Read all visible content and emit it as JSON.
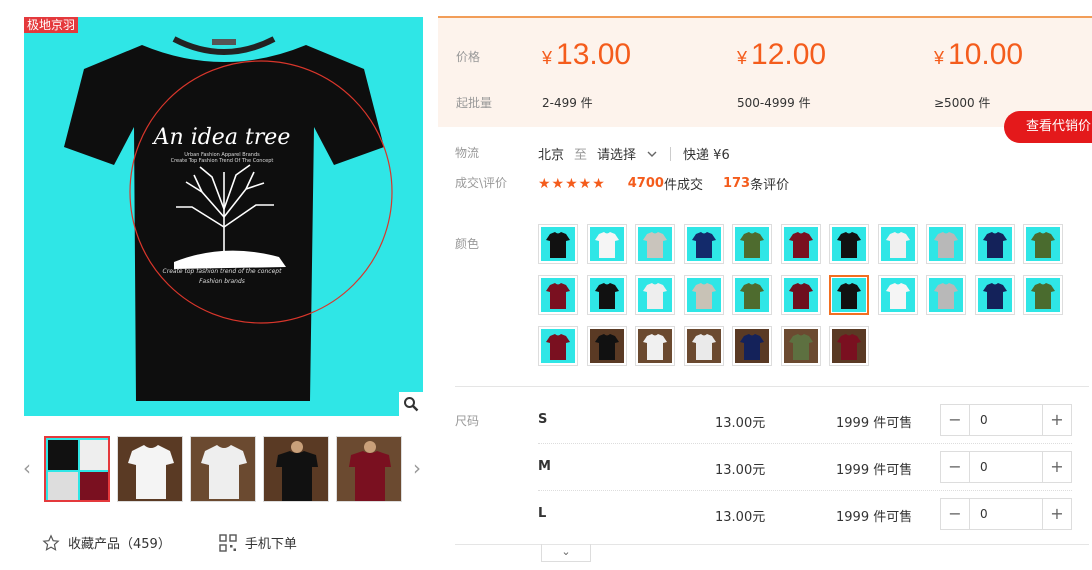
{
  "gallery": {
    "brand_tag": "极地京羽",
    "main_print_title": "An idea tree",
    "main_print_sub1": "Urban Fashion Apparel Brands",
    "main_print_sub2": "Create Top Fashion Trend Of The Concept",
    "main_print_sub3": "Create top fashion trend of the concept",
    "main_print_sub4": "Fashion brands",
    "prev_arrow": "‹",
    "next_arrow": "›"
  },
  "actions": {
    "favorite_label": "收藏产品（459）",
    "mobile_label": "手机下单"
  },
  "price": {
    "label": "价格",
    "moq_label": "起批量",
    "currency": "¥",
    "tiers": [
      {
        "price": "13.00",
        "qty": "2-499  件"
      },
      {
        "price": "12.00",
        "qty": "500-4999  件"
      },
      {
        "price": "10.00",
        "qty": "≥5000  件"
      }
    ],
    "agent_button": "查看代销价"
  },
  "logistics": {
    "label": "物流",
    "from": "北京",
    "to_word": "至",
    "select": "请选择",
    "express": "快递 ¥6"
  },
  "deal": {
    "label": "成交\\评价",
    "stars": "★★★★★",
    "count": "4700",
    "count_unit": " 件成交",
    "reviews": "173",
    "reviews_unit": " 条评价"
  },
  "color": {
    "label": "颜色"
  },
  "size": {
    "label": "尺码",
    "rows": [
      {
        "name": "S",
        "price": "13.00元",
        "stock": "1999 件可售",
        "qty": "0"
      },
      {
        "name": "M",
        "price": "13.00元",
        "stock": "1999 件可售",
        "qty": "0"
      },
      {
        "name": "L",
        "price": "13.00元",
        "stock": "1999 件可售",
        "qty": "0"
      }
    ],
    "minus": "−",
    "plus": "+"
  },
  "more_icon": "⌄",
  "colors": {
    "accent": "#f45c1c",
    "brand_red": "#e4393c",
    "cyan_bg": "#2fe6e6",
    "price_bg": "#fdf3ec"
  }
}
